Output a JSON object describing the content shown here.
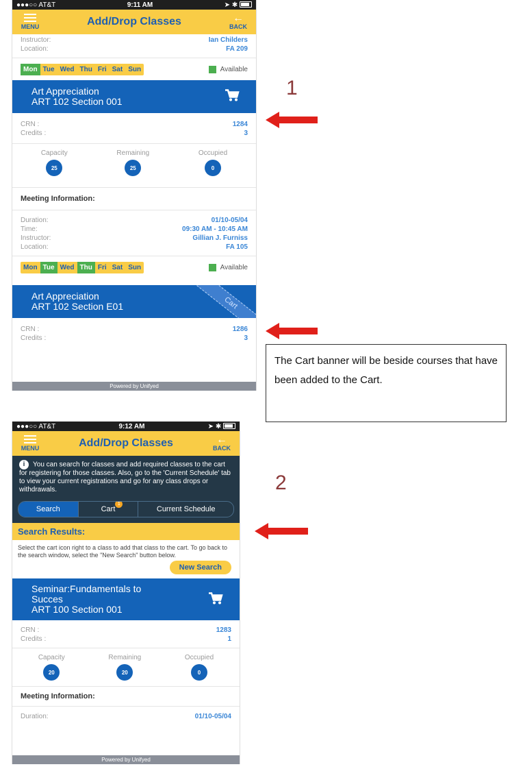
{
  "screen1": {
    "status": {
      "carrier": "●●●○○ AT&T",
      "time": "9:11 AM"
    },
    "appbar": {
      "menu": "MENU",
      "title": "Add/Drop Classes",
      "back": "BACK"
    },
    "top_instructor": {
      "k": "Instructor:",
      "v": "Ian Childers"
    },
    "top_location": {
      "k": "Location:",
      "v": "FA 209"
    },
    "days1": [
      "Mon",
      "Tue",
      "Wed",
      "Thu",
      "Fri",
      "Sat",
      "Sun"
    ],
    "available": "Available",
    "course1": {
      "name": "Art Appreciation",
      "section": "ART 102 Section 001"
    },
    "crn1": {
      "k": "CRN :",
      "v": "1284"
    },
    "credits1": {
      "k": "Credits :",
      "v": "3"
    },
    "stats": {
      "capacity": "Capacity",
      "remaining": "Remaining",
      "occupied": "Occupied",
      "capacity_val": "25",
      "remaining_val": "25",
      "occupied_val": "0"
    },
    "meeting_title": "Meeting Information:",
    "duration": {
      "k": "Duration:",
      "v": "01/10-05/04"
    },
    "time": {
      "k": "Time:",
      "v": "09:30 AM - 10:45 AM"
    },
    "instructor": {
      "k": "Instructor:",
      "v": "Gillian J. Furniss"
    },
    "location": {
      "k": "Location:",
      "v": "FA 105"
    },
    "days2": [
      "Mon",
      "Tue",
      "Wed",
      "Thu",
      "Fri",
      "Sat",
      "Sun"
    ],
    "course2": {
      "name": "Art Appreciation",
      "section": "ART 102 Section E01",
      "ribbon": "Cart"
    },
    "crn2": {
      "k": "CRN :",
      "v": "1286"
    },
    "credits2": {
      "k": "Credits :",
      "v": "3"
    },
    "footer": "Powered by Unifyed"
  },
  "screen2": {
    "status": {
      "carrier": "●●●○○ AT&T",
      "time": "9:12 AM"
    },
    "appbar": {
      "menu": "MENU",
      "title": "Add/Drop Classes",
      "back": "BACK"
    },
    "info": "You can search for classes and add required classes to the cart for registering for those classes. Also, go to the 'Current Schedule' tab to view your current registrations and go for any class drops or withdrawals.",
    "tabs": {
      "search": "Search",
      "cart": "Cart",
      "cart_badge": "1",
      "schedule": "Current Schedule"
    },
    "sr_title": "Search Results:",
    "sr_text": "Select the cart icon right to a class to add that class to the cart. To go back to the search window, select the \"New Search\" button below.",
    "new_search": "New Search",
    "course": {
      "name": "Seminar:Fundamentals to",
      "name2": "Succes",
      "section": "ART 100 Section 001"
    },
    "crn": {
      "k": "CRN :",
      "v": "1283"
    },
    "credits": {
      "k": "Credits :",
      "v": "1"
    },
    "stats": {
      "capacity": "Capacity",
      "remaining": "Remaining",
      "occupied": "Occupied",
      "capacity_val": "20",
      "remaining_val": "20",
      "occupied_val": "0"
    },
    "meeting_title": "Meeting Information:",
    "duration": {
      "k": "Duration:",
      "v": "01/10-05/04"
    },
    "footer": "Powered by Unifyed"
  },
  "annotations": {
    "num1": "1",
    "num2": "2",
    "callout": "The Cart banner will be beside courses that have been added to the Cart.",
    "arrow_color": "#e0201a"
  }
}
